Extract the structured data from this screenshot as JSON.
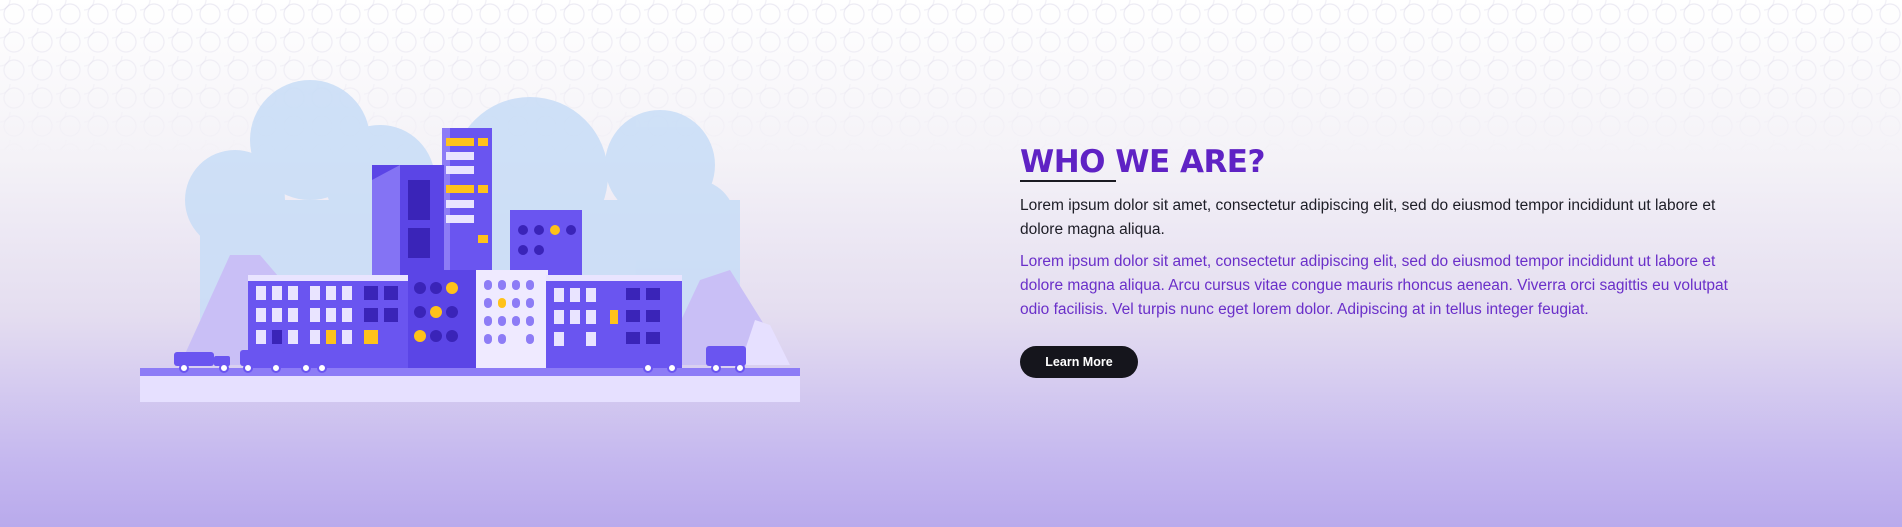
{
  "about": {
    "title": "WHO WE ARE?",
    "paragraph_primary": "Lorem ipsum dolor sit amet, consectetur adipiscing elit, sed do eiusmod tempor incididunt ut labore et dolore magna aliqua.",
    "paragraph_secondary": "Lorem ipsum dolor sit amet, consectetur adipiscing elit, sed do eiusmod tempor incididunt ut labore et dolore magna aliqua. Arcu cursus vitae congue mauris rhoncus aenean. Viverra orci sagittis eu volutpat odio facilisis. Vel turpis nunc eget lorem dolor. Adipiscing at in tellus integer feugiat.",
    "button_label": "Learn More"
  },
  "colors": {
    "title": "#5f22c4",
    "accent_text": "#6a2fc9",
    "button_bg": "#15151c",
    "building_primary": "#6a55f0",
    "window_highlight": "#ffc21a"
  },
  "illustration": {
    "icon": "city-buildings-illustration"
  }
}
